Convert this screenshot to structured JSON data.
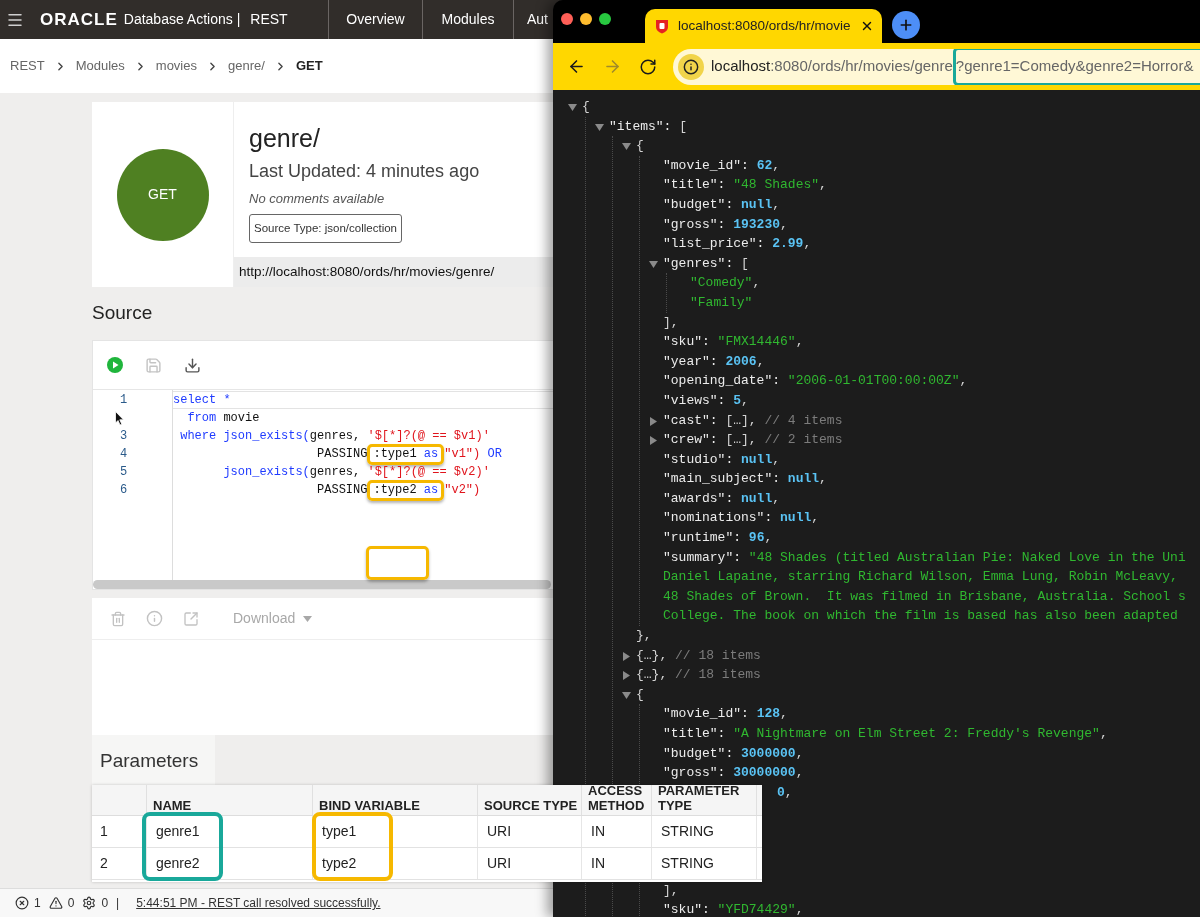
{
  "app_header": {
    "brand": "ORACLE",
    "product": "Database Actions |",
    "section": "REST",
    "nav": [
      "Overview",
      "Modules",
      "Aut"
    ]
  },
  "breadcrumb": [
    "REST",
    "Modules",
    "movies",
    "genre/",
    "GET"
  ],
  "handler": {
    "method": "GET",
    "title": "genre/",
    "updated": "Last Updated: 4 minutes ago",
    "comments": "No comments available",
    "source_type": "Source Type: json/collection",
    "url": "http://localhost:8080/ords/hr/movies/genre/"
  },
  "source": {
    "title": "Source",
    "toolbar": [
      {
        "kind": "run",
        "disabled": false
      },
      {
        "kind": "save",
        "disabled": true
      },
      {
        "kind": "download",
        "disabled": false
      }
    ],
    "lines": [
      {
        "number": "1",
        "active": true,
        "tokens": [
          {
            "kind": "kw",
            "text": "select"
          },
          {
            "kind": "kw",
            "text": " *"
          }
        ]
      },
      {
        "cursor": true,
        "active": false,
        "tokens": [
          {
            "kind": "kw",
            "text": "  from"
          },
          {
            "kind": "plain",
            "text": " movie"
          }
        ]
      },
      {
        "number": "3",
        "active": false,
        "tokens": [
          {
            "kind": "kw",
            "text": " where json_exists("
          },
          {
            "kind": "plain",
            "text": "genres, "
          },
          {
            "kind": "str",
            "text": "'$[*]?(@ == $v1)'"
          }
        ]
      },
      {
        "number": "4",
        "active": false,
        "tokens": [
          {
            "kind": "plain",
            "text": "                    PASSING"
          },
          {
            "kind": "highlight",
            "tokens": [
              {
                "kind": "plain",
                "text": ":type1 "
              },
              {
                "kind": "kw",
                "text": "as"
              }
            ]
          },
          {
            "kind": "str",
            "text": "\"v1\")"
          },
          {
            "kind": "kw",
            "text": " OR"
          }
        ]
      },
      {
        "number": "5",
        "active": false,
        "tokens": [
          {
            "kind": "kw",
            "text": "       json_exists("
          },
          {
            "kind": "plain",
            "text": "genres, "
          },
          {
            "kind": "str",
            "text": "'$[*]?(@ == $v2)'"
          }
        ]
      },
      {
        "number": "6",
        "active": false,
        "tokens": [
          {
            "kind": "plain",
            "text": "                    PASSING"
          },
          {
            "kind": "highlight",
            "tokens": [
              {
                "kind": "plain",
                "text": ":type2 "
              },
              {
                "kind": "kw",
                "text": "as"
              }
            ]
          },
          {
            "kind": "str",
            "text": "\"v2\")"
          }
        ]
      }
    ]
  },
  "results_toolbar": {
    "download": "Download"
  },
  "parameters": {
    "title": "Parameters",
    "columns": [
      "NAME",
      "BIND VARIABLE",
      "SOURCE TYPE",
      "ACCESS METHOD",
      "PARAMETER TYPE"
    ],
    "rows": [
      {
        "index": "1",
        "cells": [
          "genre1",
          "type1",
          "URI",
          "IN",
          "STRING"
        ]
      },
      {
        "index": "2",
        "cells": [
          "genre2",
          "type2",
          "URI",
          "IN",
          "STRING"
        ]
      }
    ]
  },
  "status_bar": {
    "errors": "1",
    "warnings": "0",
    "settings": "0",
    "separator": "|",
    "message": "5:44:51 PM - REST call resolved successfully."
  },
  "browser": {
    "tab_title": "localhost:8080/ords/hr/movie",
    "nav": [
      {
        "kind": "back",
        "disabled": false
      },
      {
        "kind": "forward",
        "disabled": true
      },
      {
        "kind": "reload",
        "disabled": false
      }
    ],
    "address": {
      "host": "localhost",
      "path": ":8080/ords/hr/movies/genre",
      "query": "?genre1=Comedy&genre2=Horror&"
    },
    "json_view": {
      "tokens": [
        {
          "kind": "p",
          "text": "{"
        }
      ],
      "expanded": true,
      "children": [
        {
          "tokens": [
            {
              "kind": "key",
              "text": "\"items\": "
            },
            {
              "kind": "p",
              "text": "["
            }
          ],
          "expanded": true,
          "children": [
            {
              "tokens": [
                {
                  "kind": "p",
                  "text": "{"
                }
              ],
              "expanded": true,
              "closing": [
                {
                  "kind": "p",
                  "text": "},"
                }
              ],
              "children": [
                {
                  "tokens": [
                    {
                      "kind": "key",
                      "text": "\"movie_id\": "
                    },
                    {
                      "kind": "num",
                      "text": "62"
                    },
                    {
                      "kind": "p",
                      "text": ","
                    }
                  ]
                },
                {
                  "tokens": [
                    {
                      "kind": "key",
                      "text": "\"title\": "
                    },
                    {
                      "kind": "str",
                      "text": "\"48 Shades\""
                    },
                    {
                      "kind": "p",
                      "text": ","
                    }
                  ]
                },
                {
                  "tokens": [
                    {
                      "kind": "key",
                      "text": "\"budget\": "
                    },
                    {
                      "kind": "num",
                      "text": "null"
                    },
                    {
                      "kind": "p",
                      "text": ","
                    }
                  ]
                },
                {
                  "tokens": [
                    {
                      "kind": "key",
                      "text": "\"gross\": "
                    },
                    {
                      "kind": "num",
                      "text": "193230"
                    },
                    {
                      "kind": "p",
                      "text": ","
                    }
                  ]
                },
                {
                  "tokens": [
                    {
                      "kind": "key",
                      "text": "\"list_price\": "
                    },
                    {
                      "kind": "num",
                      "text": "2.99"
                    },
                    {
                      "kind": "p",
                      "text": ","
                    }
                  ]
                },
                {
                  "tokens": [
                    {
                      "kind": "key",
                      "text": "\"genres\": "
                    },
                    {
                      "kind": "p",
                      "text": "["
                    }
                  ],
                  "expanded": true,
                  "closing": [
                    {
                      "kind": "p",
                      "text": "],"
                    }
                  ],
                  "children": [
                    {
                      "tokens": [
                        {
                          "kind": "str",
                          "text": "\"Comedy\""
                        },
                        {
                          "kind": "p",
                          "text": ","
                        }
                      ]
                    },
                    {
                      "tokens": [
                        {
                          "kind": "str",
                          "text": "\"Family\""
                        }
                      ]
                    }
                  ]
                },
                {
                  "tokens": [
                    {
                      "kind": "key",
                      "text": "\"sku\": "
                    },
                    {
                      "kind": "str",
                      "text": "\"FMX14446\""
                    },
                    {
                      "kind": "p",
                      "text": ","
                    }
                  ]
                },
                {
                  "tokens": [
                    {
                      "kind": "key",
                      "text": "\"year\": "
                    },
                    {
                      "kind": "num",
                      "text": "2006"
                    },
                    {
                      "kind": "p",
                      "text": ","
                    }
                  ]
                },
                {
                  "tokens": [
                    {
                      "kind": "key",
                      "text": "\"opening_date\": "
                    },
                    {
                      "kind": "str",
                      "text": "\"2006-01-01T00:00:00Z\""
                    },
                    {
                      "kind": "p",
                      "text": ","
                    }
                  ]
                },
                {
                  "tokens": [
                    {
                      "kind": "key",
                      "text": "\"views\": "
                    },
                    {
                      "kind": "num",
                      "text": "5"
                    },
                    {
                      "kind": "p",
                      "text": ","
                    }
                  ]
                },
                {
                  "tokens": [
                    {
                      "kind": "key",
                      "text": "\"cast\": "
                    },
                    {
                      "kind": "p",
                      "text": "[…],"
                    },
                    {
                      "kind": "c",
                      "text": " // 4 items"
                    }
                  ],
                  "expanded": false
                },
                {
                  "tokens": [
                    {
                      "kind": "key",
                      "text": "\"crew\": "
                    },
                    {
                      "kind": "p",
                      "text": "[…],"
                    },
                    {
                      "kind": "c",
                      "text": " // 2 items"
                    }
                  ],
                  "expanded": false
                },
                {
                  "tokens": [
                    {
                      "kind": "key",
                      "text": "\"studio\": "
                    },
                    {
                      "kind": "num",
                      "text": "null"
                    },
                    {
                      "kind": "p",
                      "text": ","
                    }
                  ]
                },
                {
                  "tokens": [
                    {
                      "kind": "key",
                      "text": "\"main_subject\": "
                    },
                    {
                      "kind": "num",
                      "text": "null"
                    },
                    {
                      "kind": "p",
                      "text": ","
                    }
                  ]
                },
                {
                  "tokens": [
                    {
                      "kind": "key",
                      "text": "\"awards\": "
                    },
                    {
                      "kind": "num",
                      "text": "null"
                    },
                    {
                      "kind": "p",
                      "text": ","
                    }
                  ]
                },
                {
                  "tokens": [
                    {
                      "kind": "key",
                      "text": "\"nominations\": "
                    },
                    {
                      "kind": "num",
                      "text": "null"
                    },
                    {
                      "kind": "p",
                      "text": ","
                    }
                  ]
                },
                {
                  "tokens": [
                    {
                      "kind": "key",
                      "text": "\"runtime\": "
                    },
                    {
                      "kind": "num",
                      "text": "96"
                    },
                    {
                      "kind": "p",
                      "text": ","
                    }
                  ]
                },
                {
                  "tokens": [
                    {
                      "kind": "key",
                      "text": "\"summary\": "
                    },
                    {
                      "kind": "str",
                      "text": "\"48 Shades (titled Australian Pie: Naked Love in the Uni"
                    }
                  ],
                  "wrap": [
                    "Daniel Lapaine, starring Richard Wilson, Emma Lung, Robin McLeavy,",
                    "48 Shades of Brown.  It was filmed in Brisbane, Australia. School s",
                    "College. The book on which the film is based has also been adapted"
                  ]
                }
              ]
            },
            {
              "tokens": [
                {
                  "kind": "p",
                  "text": "{…},"
                },
                {
                  "kind": "c",
                  "text": " // 18 items"
                }
              ],
              "expanded": false
            },
            {
              "tokens": [
                {
                  "kind": "p",
                  "text": "{…},"
                },
                {
                  "kind": "c",
                  "text": " // 18 items"
                }
              ],
              "expanded": false
            },
            {
              "tokens": [
                {
                  "kind": "p",
                  "text": "{"
                }
              ],
              "expanded": true,
              "children": [
                {
                  "tokens": [
                    {
                      "kind": "key",
                      "text": "\"movie_id\": "
                    },
                    {
                      "kind": "num",
                      "text": "128"
                    },
                    {
                      "kind": "p",
                      "text": ","
                    }
                  ]
                },
                {
                  "tokens": [
                    {
                      "kind": "key",
                      "text": "\"title\": "
                    },
                    {
                      "kind": "str",
                      "text": "\"A Nightmare on Elm Street 2: Freddy's Revenge\""
                    },
                    {
                      "kind": "p",
                      "text": ","
                    }
                  ]
                },
                {
                  "tokens": [
                    {
                      "kind": "key",
                      "text": "\"budget\": "
                    },
                    {
                      "kind": "num",
                      "text": "3000000"
                    },
                    {
                      "kind": "p",
                      "text": ","
                    }
                  ]
                },
                {
                  "tokens": [
                    {
                      "kind": "key",
                      "text": "\"gross\": "
                    },
                    {
                      "kind": "num",
                      "text": "30000000"
                    },
                    {
                      "kind": "p",
                      "text": ","
                    }
                  ]
                },
                {
                  "kind": "covered",
                  "tokens": [
                    {
                      "kind": "num",
                      "text": "0"
                    },
                    {
                      "kind": "p",
                      "text": ","
                    }
                  ]
                },
                {
                  "kind": "hidden"
                },
                {
                  "kind": "hidden"
                },
                {
                  "kind": "hidden"
                },
                {
                  "kind": "hidden"
                },
                {
                  "tokens": [
                    {
                      "kind": "p",
                      "text": "],"
                    }
                  ]
                },
                {
                  "tokens": [
                    {
                      "kind": "key",
                      "text": "\"sku\": "
                    },
                    {
                      "kind": "str",
                      "text": "\"YFD74429\""
                    },
                    {
                      "kind": "p",
                      "text": ","
                    }
                  ]
                }
              ]
            }
          ]
        }
      ]
    }
  }
}
